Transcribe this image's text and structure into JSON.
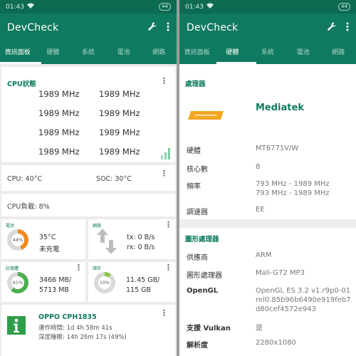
{
  "status": {
    "time": "01:43",
    "battery": "44"
  },
  "app": {
    "title": "DevCheck"
  },
  "left_tabs": [
    "資訊面板",
    "硬體",
    "系統",
    "電池",
    "網路"
  ],
  "right_tabs": [
    "資訊面板",
    "硬體",
    "系統",
    "電池",
    "網路"
  ],
  "cpu_status": {
    "title": "CPU狀態",
    "freqs": [
      "1989 MHz",
      "1989 MHz",
      "1989 MHz",
      "1989 MHz",
      "1989 MHz",
      "1989 MHz",
      "1989 MHz",
      "1989 MHz"
    ]
  },
  "temps": {
    "cpu": "CPU: 40°C",
    "soc": "SOC: 30°C"
  },
  "cpu_load": "CPU負載: 8%",
  "battery_card": {
    "label": "電池",
    "percent": "44%",
    "level": 0.44,
    "temp": "35°C",
    "state": "未充電"
  },
  "network_card": {
    "label": "網路",
    "tx": "tx: 0 B/s",
    "rx": "rx: 0 B/s"
  },
  "ram_card": {
    "label": "記憶體",
    "percent": "61%",
    "level": 0.61,
    "used": "3466 MB/",
    "total": "5713 MB"
  },
  "storage_card": {
    "label": "儲存",
    "percent": "10%",
    "level": 0.1,
    "used": "11.45 GB/",
    "total": "115 GB"
  },
  "device_card": {
    "name": "OPPO CPH1835",
    "uptime": "運作時間: 1d 4h 58m 41s",
    "deepsleep": "深度睡眠: 14h 26m 17s (49%)"
  },
  "processor": {
    "section": "處理器",
    "brand": "Mediatek",
    "logo_text": "MEDIATEK",
    "rows": [
      {
        "label": "硬體",
        "value": "MT6771V/W"
      },
      {
        "label": "核心數",
        "value": "8"
      },
      {
        "label": "頻率",
        "value": "793 MHz - 1989 MHz",
        "value2": "793 MHz - 1989 MHz"
      },
      {
        "label": "調速器",
        "value": "EE"
      }
    ]
  },
  "gpu": {
    "section": "圖形處理器",
    "rows": [
      {
        "label": "供應商",
        "value": "ARM"
      },
      {
        "label": "圖形處理器",
        "value": "Mali-G72 MP3"
      },
      {
        "label": "OpenGL",
        "value": "OpenGL ES 3.2 v1.r9p0-01",
        "value2": "rel0.85b96b6490e919feb7",
        "value3": "d80cef4572e943"
      },
      {
        "label": "支援 Vulkan",
        "value": "是"
      },
      {
        "label": "解析度",
        "value": "2280x1080"
      }
    ]
  }
}
